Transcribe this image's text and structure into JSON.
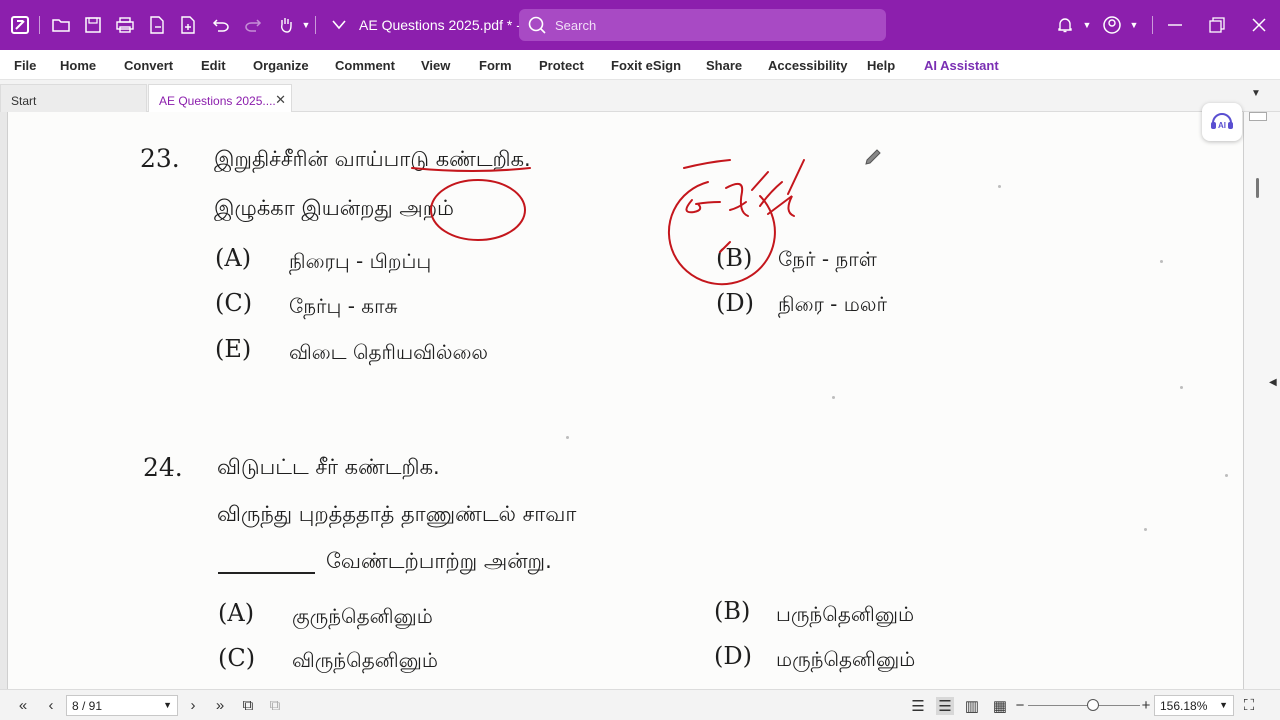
{
  "app": {
    "document_title": "AE Questions 2025.pdf * - ...",
    "search_placeholder": "Search",
    "accent_color": "#8c1fad"
  },
  "menu": {
    "items": [
      "File",
      "Home",
      "Convert",
      "Edit",
      "Organize",
      "Comment",
      "View",
      "Form",
      "Protect",
      "Foxit eSign",
      "Share",
      "Accessibility",
      "Help",
      "AI Assistant"
    ]
  },
  "tabs": [
    {
      "label": "Start"
    },
    {
      "label": "AE Questions 2025...."
    }
  ],
  "content": {
    "q23": {
      "number": "23.",
      "question": "இறுதிச்சீரின் வாய்பாடு கண்டறிக.",
      "line2": "இழுக்கா இயன்றது அறம்",
      "options": [
        {
          "label": "(A)",
          "text": "நிரைபு - பிறப்பு"
        },
        {
          "label": "(B)",
          "text": "நேர் - நாள்"
        },
        {
          "label": "(C)",
          "text": "நேர்பு - காசு"
        },
        {
          "label": "(D)",
          "text": "நிரை - மலர்"
        },
        {
          "label": "(E)",
          "text": "விடை தெரியவில்லை"
        }
      ]
    },
    "q24": {
      "number": "24.",
      "question": "விடுபட்ட சீர் கண்டறிக.",
      "line2": "விருந்து புறத்ததாத் தாணுண்டல் சாவா",
      "line3": "வேண்டற்பாற்று அன்று.",
      "options": [
        {
          "label": "(A)",
          "text": "குருந்தெனினும்"
        },
        {
          "label": "(B)",
          "text": "பருந்தெனினும்"
        },
        {
          "label": "(C)",
          "text": "விருந்தெனினும்"
        },
        {
          "label": "(D)",
          "text": "மருந்தெனினும்"
        }
      ]
    },
    "annotation_color": "#c4161c"
  },
  "status": {
    "page": "8 / 91",
    "zoom": "156.18%",
    "zoom_fraction": 0.53
  }
}
